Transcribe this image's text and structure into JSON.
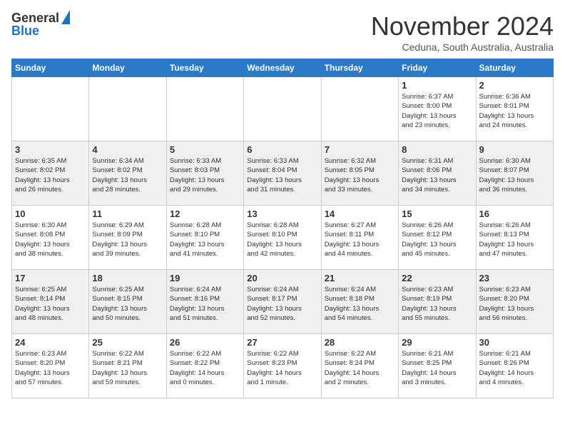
{
  "header": {
    "logo_line1": "General",
    "logo_line2": "Blue",
    "month": "November 2024",
    "location": "Ceduna, South Australia, Australia"
  },
  "weekdays": [
    "Sunday",
    "Monday",
    "Tuesday",
    "Wednesday",
    "Thursday",
    "Friday",
    "Saturday"
  ],
  "weeks": [
    [
      {
        "day": "",
        "info": ""
      },
      {
        "day": "",
        "info": ""
      },
      {
        "day": "",
        "info": ""
      },
      {
        "day": "",
        "info": ""
      },
      {
        "day": "",
        "info": ""
      },
      {
        "day": "1",
        "info": "Sunrise: 6:37 AM\nSunset: 8:00 PM\nDaylight: 13 hours\nand 23 minutes."
      },
      {
        "day": "2",
        "info": "Sunrise: 6:36 AM\nSunset: 8:01 PM\nDaylight: 13 hours\nand 24 minutes."
      }
    ],
    [
      {
        "day": "3",
        "info": "Sunrise: 6:35 AM\nSunset: 8:02 PM\nDaylight: 13 hours\nand 26 minutes."
      },
      {
        "day": "4",
        "info": "Sunrise: 6:34 AM\nSunset: 8:02 PM\nDaylight: 13 hours\nand 28 minutes."
      },
      {
        "day": "5",
        "info": "Sunrise: 6:33 AM\nSunset: 8:03 PM\nDaylight: 13 hours\nand 29 minutes."
      },
      {
        "day": "6",
        "info": "Sunrise: 6:33 AM\nSunset: 8:04 PM\nDaylight: 13 hours\nand 31 minutes."
      },
      {
        "day": "7",
        "info": "Sunrise: 6:32 AM\nSunset: 8:05 PM\nDaylight: 13 hours\nand 33 minutes."
      },
      {
        "day": "8",
        "info": "Sunrise: 6:31 AM\nSunset: 8:06 PM\nDaylight: 13 hours\nand 34 minutes."
      },
      {
        "day": "9",
        "info": "Sunrise: 6:30 AM\nSunset: 8:07 PM\nDaylight: 13 hours\nand 36 minutes."
      }
    ],
    [
      {
        "day": "10",
        "info": "Sunrise: 6:30 AM\nSunset: 8:08 PM\nDaylight: 13 hours\nand 38 minutes."
      },
      {
        "day": "11",
        "info": "Sunrise: 6:29 AM\nSunset: 8:09 PM\nDaylight: 13 hours\nand 39 minutes."
      },
      {
        "day": "12",
        "info": "Sunrise: 6:28 AM\nSunset: 8:10 PM\nDaylight: 13 hours\nand 41 minutes."
      },
      {
        "day": "13",
        "info": "Sunrise: 6:28 AM\nSunset: 8:10 PM\nDaylight: 13 hours\nand 42 minutes."
      },
      {
        "day": "14",
        "info": "Sunrise: 6:27 AM\nSunset: 8:11 PM\nDaylight: 13 hours\nand 44 minutes."
      },
      {
        "day": "15",
        "info": "Sunrise: 6:26 AM\nSunset: 8:12 PM\nDaylight: 13 hours\nand 45 minutes."
      },
      {
        "day": "16",
        "info": "Sunrise: 6:26 AM\nSunset: 8:13 PM\nDaylight: 13 hours\nand 47 minutes."
      }
    ],
    [
      {
        "day": "17",
        "info": "Sunrise: 6:25 AM\nSunset: 8:14 PM\nDaylight: 13 hours\nand 48 minutes."
      },
      {
        "day": "18",
        "info": "Sunrise: 6:25 AM\nSunset: 8:15 PM\nDaylight: 13 hours\nand 50 minutes."
      },
      {
        "day": "19",
        "info": "Sunrise: 6:24 AM\nSunset: 8:16 PM\nDaylight: 13 hours\nand 51 minutes."
      },
      {
        "day": "20",
        "info": "Sunrise: 6:24 AM\nSunset: 8:17 PM\nDaylight: 13 hours\nand 52 minutes."
      },
      {
        "day": "21",
        "info": "Sunrise: 6:24 AM\nSunset: 8:18 PM\nDaylight: 13 hours\nand 54 minutes."
      },
      {
        "day": "22",
        "info": "Sunrise: 6:23 AM\nSunset: 8:19 PM\nDaylight: 13 hours\nand 55 minutes."
      },
      {
        "day": "23",
        "info": "Sunrise: 6:23 AM\nSunset: 8:20 PM\nDaylight: 13 hours\nand 56 minutes."
      }
    ],
    [
      {
        "day": "24",
        "info": "Sunrise: 6:23 AM\nSunset: 8:20 PM\nDaylight: 13 hours\nand 57 minutes."
      },
      {
        "day": "25",
        "info": "Sunrise: 6:22 AM\nSunset: 8:21 PM\nDaylight: 13 hours\nand 59 minutes."
      },
      {
        "day": "26",
        "info": "Sunrise: 6:22 AM\nSunset: 8:22 PM\nDaylight: 14 hours\nand 0 minutes."
      },
      {
        "day": "27",
        "info": "Sunrise: 6:22 AM\nSunset: 8:23 PM\nDaylight: 14 hours\nand 1 minute."
      },
      {
        "day": "28",
        "info": "Sunrise: 6:22 AM\nSunset: 8:24 PM\nDaylight: 14 hours\nand 2 minutes."
      },
      {
        "day": "29",
        "info": "Sunrise: 6:21 AM\nSunset: 8:25 PM\nDaylight: 14 hours\nand 3 minutes."
      },
      {
        "day": "30",
        "info": "Sunrise: 6:21 AM\nSunset: 8:26 PM\nDaylight: 14 hours\nand 4 minutes."
      }
    ]
  ]
}
